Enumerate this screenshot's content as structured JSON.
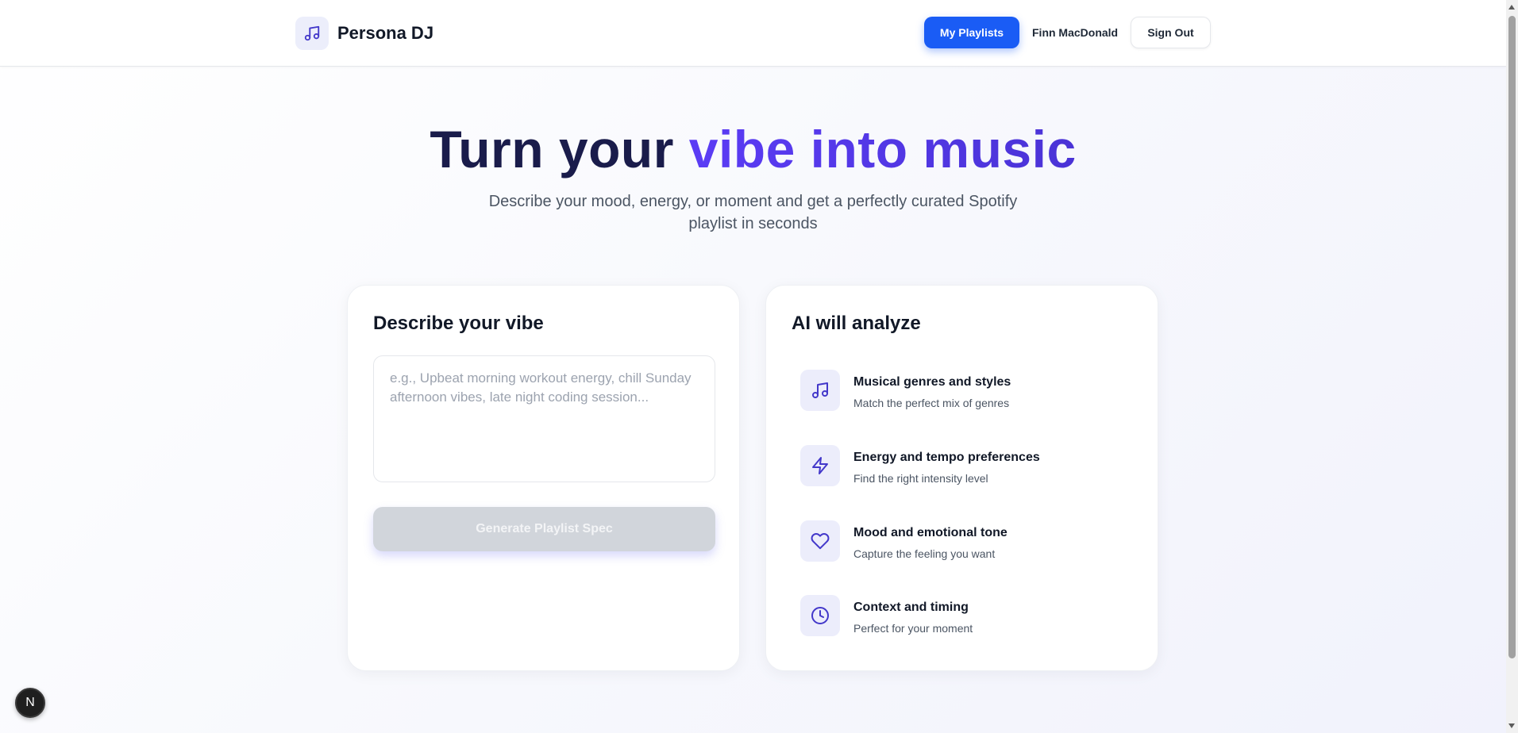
{
  "app": {
    "brand": "Persona DJ",
    "logo_icon": "music-note-icon"
  },
  "header": {
    "my_playlists_label": "My Playlists",
    "user_name": "Finn MacDonald",
    "sign_out_label": "Sign Out"
  },
  "hero": {
    "title_part1": "Turn your ",
    "title_accent": "vibe into music",
    "subtitle": "Describe your mood, energy, or moment and get a perfectly curated Spotify playlist in seconds"
  },
  "describe_card": {
    "title": "Describe your vibe",
    "input_value": "",
    "input_placeholder": "e.g., Upbeat morning workout energy, chill Sunday afternoon vibes, late night coding session...",
    "generate_label": "Generate Playlist Spec"
  },
  "analyze_card": {
    "title": "AI will analyze",
    "features": [
      {
        "icon": "music-note-icon",
        "title": "Musical genres and styles",
        "desc": "Match the perfect mix of genres"
      },
      {
        "icon": "lightning-icon",
        "title": "Energy and tempo preferences",
        "desc": "Find the right intensity level"
      },
      {
        "icon": "heart-icon",
        "title": "Mood and emotional tone",
        "desc": "Capture the feeling you want"
      },
      {
        "icon": "clock-icon",
        "title": "Context and timing",
        "desc": "Perfect for your moment"
      }
    ]
  },
  "dev_badge": {
    "label": "N"
  },
  "colors": {
    "primary": "#1a5cf5",
    "accent": "#5b3cf5",
    "icon": "#4338ca"
  }
}
